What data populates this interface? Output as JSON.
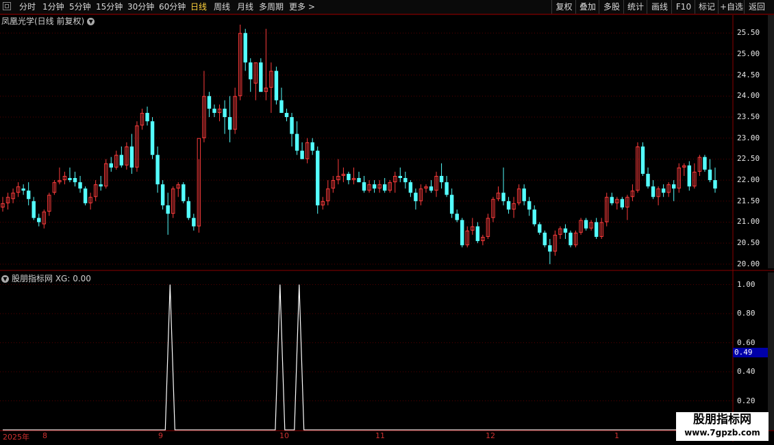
{
  "toolbar": {
    "periods": [
      {
        "label": "分时",
        "active": false
      },
      {
        "label": "1分钟",
        "active": false
      },
      {
        "label": "5分钟",
        "active": false
      },
      {
        "label": "15分钟",
        "active": false
      },
      {
        "label": "30分钟",
        "active": false
      },
      {
        "label": "60分钟",
        "active": false
      },
      {
        "label": "日线",
        "active": true
      },
      {
        "label": "周线",
        "active": false
      },
      {
        "label": "月线",
        "active": false
      },
      {
        "label": "多周期",
        "active": false
      },
      {
        "label": "更多 >",
        "active": false
      }
    ],
    "right_buttons": [
      "复权",
      "叠加",
      "多股",
      "统计",
      "画线",
      "F10",
      "标记",
      "+自选",
      "返回"
    ]
  },
  "price_panel": {
    "title": "凤凰光学(日线 前复权)",
    "y_labels": [
      "25.50",
      "25.00",
      "24.50",
      "24.00",
      "23.50",
      "23.00",
      "22.50",
      "22.00",
      "21.50",
      "21.00",
      "20.50",
      "20.00"
    ]
  },
  "indicator_panel": {
    "title": "股朋指标网 XG: 0.00",
    "y_labels": [
      "1.00",
      "0.80",
      "0.60",
      "0.40",
      "0.20"
    ],
    "current_value": "0.49"
  },
  "date_axis": [
    "2025年",
    "8",
    "9",
    "10",
    "11",
    "12",
    "1"
  ],
  "watermark": {
    "title": "股朋指标网",
    "url": "www.7gpzb.com"
  },
  "colors": {
    "up": "#ff3c3c",
    "down": "#54ffff",
    "grid": "#5a0000",
    "axis": "#8b0000",
    "signal": "#ffffff"
  },
  "chart_data": {
    "type": "candlestick",
    "ylim": [
      19.9,
      25.7
    ],
    "candles": [
      [
        21.35,
        21.6,
        21.25,
        21.45
      ],
      [
        21.45,
        21.7,
        21.3,
        21.6
      ],
      [
        21.55,
        21.8,
        21.45,
        21.7
      ],
      [
        21.7,
        21.95,
        21.6,
        21.85
      ],
      [
        21.8,
        21.9,
        21.65,
        21.75
      ],
      [
        21.75,
        21.95,
        21.4,
        21.55
      ],
      [
        21.5,
        21.6,
        21.05,
        21.1
      ],
      [
        21.1,
        21.2,
        20.9,
        21.0
      ],
      [
        20.95,
        21.3,
        20.85,
        21.25
      ],
      [
        21.25,
        21.7,
        21.15,
        21.65
      ],
      [
        21.7,
        22.0,
        21.65,
        21.95
      ],
      [
        21.95,
        22.3,
        21.9,
        22.0
      ],
      [
        22.0,
        22.2,
        21.9,
        22.1
      ],
      [
        22.05,
        22.3,
        21.95,
        22.0
      ],
      [
        22.05,
        22.2,
        21.85,
        21.95
      ],
      [
        21.95,
        22.1,
        21.7,
        21.8
      ],
      [
        21.8,
        21.85,
        21.4,
        21.45
      ],
      [
        21.45,
        21.7,
        21.3,
        21.6
      ],
      [
        21.6,
        22.0,
        21.5,
        21.9
      ],
      [
        21.9,
        22.1,
        21.75,
        21.85
      ],
      [
        21.85,
        22.5,
        21.8,
        22.4
      ],
      [
        22.4,
        22.55,
        22.2,
        22.3
      ],
      [
        22.3,
        22.7,
        22.25,
        22.6
      ],
      [
        22.6,
        22.8,
        22.3,
        22.35
      ],
      [
        22.35,
        22.9,
        22.25,
        22.8
      ],
      [
        22.8,
        23.1,
        22.15,
        22.3
      ],
      [
        22.3,
        23.4,
        22.2,
        23.3
      ],
      [
        23.3,
        23.7,
        23.2,
        23.6
      ],
      [
        23.6,
        23.75,
        23.3,
        23.4
      ],
      [
        23.4,
        23.5,
        22.5,
        22.6
      ],
      [
        22.6,
        22.8,
        21.7,
        21.9
      ],
      [
        21.9,
        22.0,
        21.3,
        21.4
      ],
      [
        21.4,
        21.7,
        20.7,
        21.2
      ],
      [
        21.2,
        21.85,
        21.1,
        21.8
      ],
      [
        21.8,
        21.95,
        21.6,
        21.9
      ],
      [
        21.9,
        21.95,
        21.45,
        21.5
      ],
      [
        21.5,
        21.6,
        21.05,
        21.1
      ],
      [
        21.1,
        21.2,
        20.8,
        20.9
      ],
      [
        20.9,
        22.5,
        20.75,
        23.0
      ],
      [
        23.0,
        24.6,
        22.9,
        24.0
      ],
      [
        24.0,
        24.1,
        23.5,
        23.7
      ],
      [
        23.7,
        23.8,
        23.5,
        23.6
      ],
      [
        23.6,
        23.8,
        23.4,
        23.7
      ],
      [
        23.7,
        23.9,
        23.1,
        23.5
      ],
      [
        23.5,
        24.0,
        22.9,
        23.2
      ],
      [
        23.2,
        24.2,
        23.1,
        24.0
      ],
      [
        24.0,
        25.7,
        23.9,
        25.5
      ],
      [
        25.5,
        25.6,
        24.6,
        24.8
      ],
      [
        24.8,
        24.9,
        24.1,
        24.4
      ],
      [
        24.3,
        24.8,
        23.9,
        24.8
      ],
      [
        24.8,
        24.9,
        24.2,
        24.1
      ],
      [
        24.1,
        25.6,
        23.9,
        24.2
      ],
      [
        24.2,
        24.8,
        23.6,
        24.6
      ],
      [
        24.6,
        24.7,
        23.8,
        23.9
      ],
      [
        23.9,
        24.2,
        23.6,
        23.6
      ],
      [
        23.6,
        23.7,
        23.4,
        23.5
      ],
      [
        23.5,
        23.6,
        22.8,
        23.1
      ],
      [
        23.1,
        23.4,
        22.6,
        22.7
      ],
      [
        22.7,
        22.9,
        22.5,
        22.5
      ],
      [
        22.5,
        23.0,
        22.4,
        22.9
      ],
      [
        22.9,
        23.0,
        22.6,
        22.7
      ],
      [
        22.7,
        22.8,
        21.2,
        21.4
      ],
      [
        21.4,
        21.6,
        21.3,
        21.5
      ],
      [
        21.5,
        22.0,
        21.4,
        21.8
      ],
      [
        21.8,
        22.1,
        21.7,
        22.0
      ],
      [
        22.0,
        22.5,
        21.9,
        22.1
      ],
      [
        22.1,
        22.3,
        21.95,
        22.15
      ],
      [
        22.15,
        22.2,
        21.9,
        22.0
      ],
      [
        22.0,
        22.3,
        21.9,
        22.05
      ],
      [
        22.05,
        22.2,
        21.95,
        21.95
      ],
      [
        21.95,
        22.1,
        21.7,
        21.75
      ],
      [
        21.75,
        22.0,
        21.7,
        21.9
      ],
      [
        21.9,
        22.0,
        21.7,
        21.8
      ],
      [
        21.8,
        22.0,
        21.7,
        21.9
      ],
      [
        21.9,
        22.05,
        21.7,
        21.75
      ],
      [
        21.75,
        22.0,
        21.7,
        21.95
      ],
      [
        21.95,
        22.2,
        21.7,
        22.1
      ],
      [
        22.1,
        22.3,
        21.95,
        22.05
      ],
      [
        22.05,
        22.2,
        21.8,
        21.95
      ],
      [
        21.95,
        22.0,
        21.6,
        21.7
      ],
      [
        21.7,
        21.8,
        21.3,
        21.5
      ],
      [
        21.5,
        21.9,
        21.4,
        21.8
      ],
      [
        21.8,
        21.9,
        21.7,
        21.85
      ],
      [
        21.85,
        22.0,
        21.7,
        21.75
      ],
      [
        21.75,
        22.2,
        21.6,
        22.1
      ],
      [
        22.1,
        22.4,
        21.8,
        21.95
      ],
      [
        21.95,
        22.1,
        21.6,
        21.65
      ],
      [
        21.65,
        21.8,
        21.1,
        21.2
      ],
      [
        21.2,
        21.3,
        21.0,
        21.05
      ],
      [
        21.05,
        21.1,
        20.4,
        20.45
      ],
      [
        20.45,
        20.9,
        20.4,
        20.8
      ],
      [
        20.8,
        21.1,
        20.7,
        20.9
      ],
      [
        20.9,
        21.0,
        20.5,
        20.55
      ],
      [
        20.55,
        20.7,
        20.45,
        20.65
      ],
      [
        20.65,
        21.2,
        20.6,
        21.1
      ],
      [
        21.1,
        21.6,
        21.0,
        21.55
      ],
      [
        21.55,
        21.85,
        21.5,
        21.7
      ],
      [
        21.7,
        22.3,
        21.4,
        21.5
      ],
      [
        21.5,
        21.6,
        21.2,
        21.3
      ],
      [
        21.3,
        21.6,
        21.1,
        21.45
      ],
      [
        21.45,
        21.9,
        21.4,
        21.8
      ],
      [
        21.8,
        21.9,
        21.4,
        21.5
      ],
      [
        21.5,
        21.6,
        21.15,
        21.3
      ],
      [
        21.3,
        21.4,
        20.9,
        20.95
      ],
      [
        20.95,
        21.0,
        20.7,
        20.75
      ],
      [
        20.75,
        20.8,
        20.4,
        20.45
      ],
      [
        20.45,
        20.6,
        20.0,
        20.3
      ],
      [
        20.3,
        20.8,
        20.2,
        20.7
      ],
      [
        20.7,
        20.9,
        20.6,
        20.85
      ],
      [
        20.85,
        20.95,
        20.6,
        20.75
      ],
      [
        20.75,
        20.8,
        20.4,
        20.45
      ],
      [
        20.45,
        20.8,
        20.4,
        20.75
      ],
      [
        20.75,
        21.1,
        20.7,
        21.05
      ],
      [
        21.05,
        21.1,
        20.8,
        20.85
      ],
      [
        20.85,
        21.05,
        20.8,
        21.0
      ],
      [
        21.0,
        21.1,
        20.6,
        20.65
      ],
      [
        20.65,
        21.1,
        20.6,
        21.0
      ],
      [
        21.0,
        21.7,
        20.9,
        21.6
      ],
      [
        21.6,
        21.7,
        21.4,
        21.45
      ],
      [
        21.45,
        21.6,
        21.3,
        21.55
      ],
      [
        21.55,
        21.6,
        21.3,
        21.35
      ],
      [
        21.35,
        21.65,
        21.05,
        21.6
      ],
      [
        21.6,
        21.9,
        21.5,
        21.75
      ],
      [
        21.75,
        22.9,
        21.7,
        22.8
      ],
      [
        22.8,
        22.9,
        22.1,
        22.15
      ],
      [
        22.15,
        22.3,
        21.8,
        21.85
      ],
      [
        21.85,
        22.0,
        21.55,
        21.6
      ],
      [
        21.6,
        21.85,
        21.4,
        21.8
      ],
      [
        21.8,
        21.9,
        21.6,
        21.7
      ],
      [
        21.7,
        21.95,
        21.6,
        21.9
      ],
      [
        21.9,
        22.0,
        21.5,
        21.8
      ],
      [
        21.8,
        22.4,
        21.7,
        22.3
      ],
      [
        22.3,
        22.4,
        22.1,
        22.35
      ],
      [
        22.35,
        22.45,
        21.75,
        21.85
      ],
      [
        21.85,
        22.4,
        21.8,
        22.2
      ],
      [
        22.2,
        22.6,
        22.1,
        22.55
      ],
      [
        22.55,
        22.6,
        22.2,
        22.25
      ],
      [
        22.25,
        22.5,
        21.95,
        22.0
      ],
      [
        22.0,
        22.3,
        21.7,
        21.8
      ]
    ],
    "xg_signal": {
      "count": 150,
      "peaks": [
        35,
        58,
        62
      ],
      "ylim": [
        0,
        1.05
      ]
    }
  }
}
